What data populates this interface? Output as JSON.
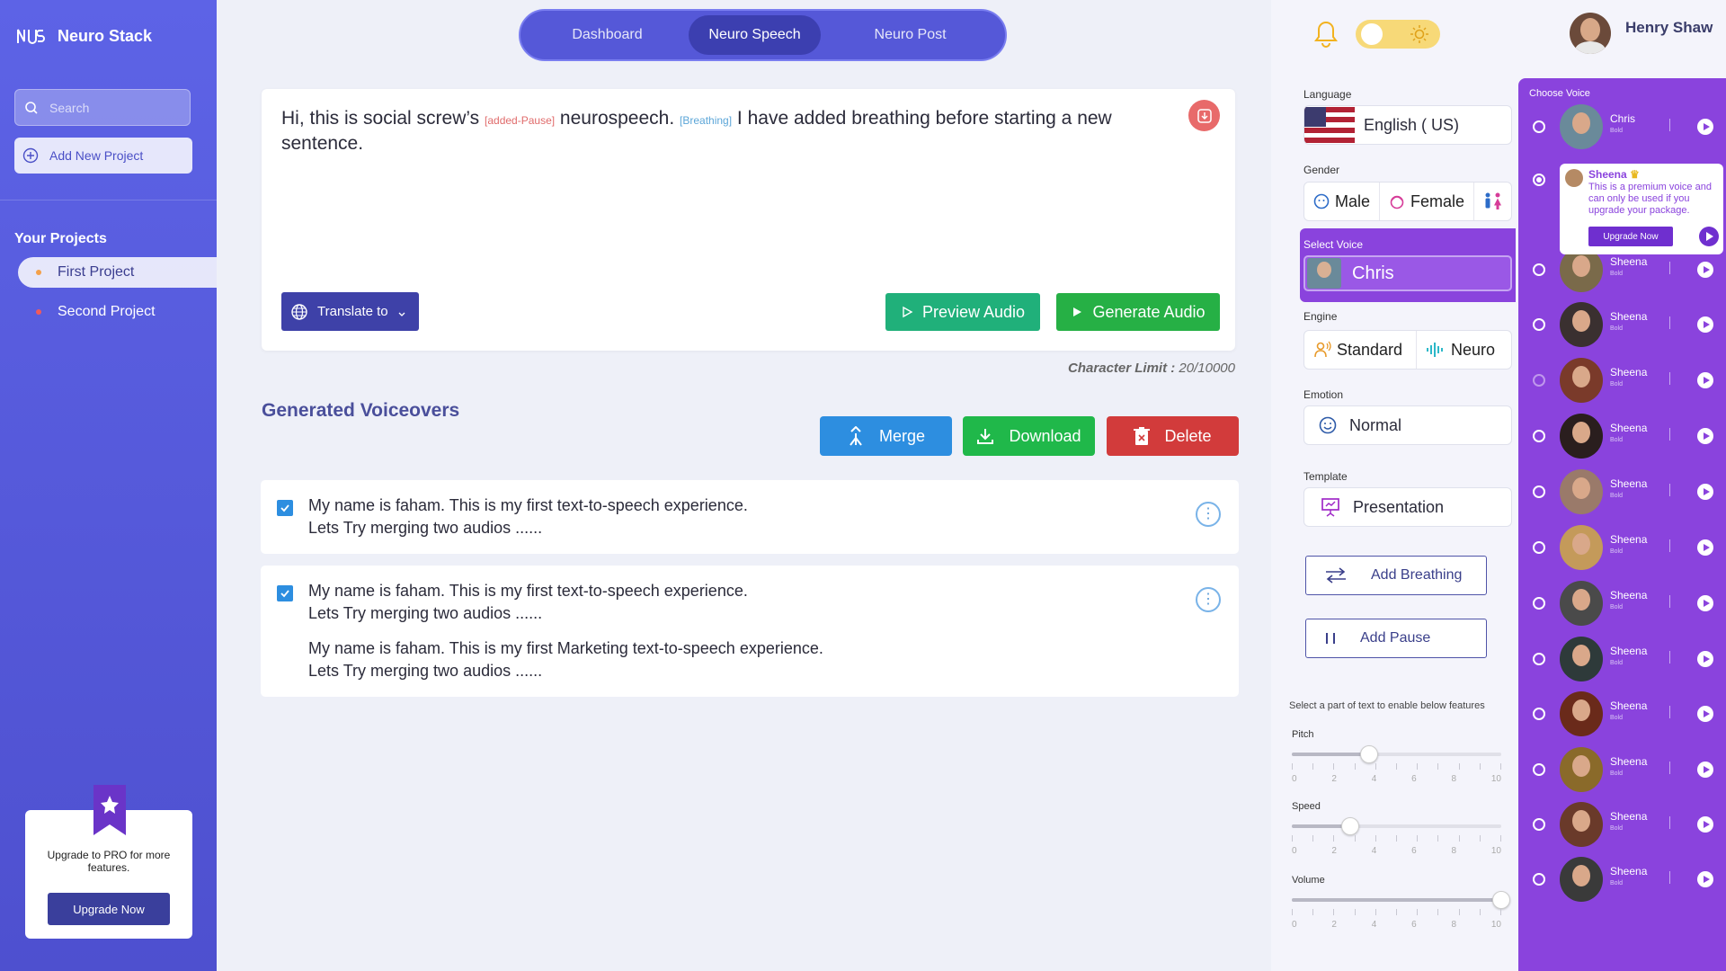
{
  "app": {
    "name": "Neuro Stack"
  },
  "sidebar": {
    "search_placeholder": "Search",
    "add_project": "Add New Project",
    "projects_heading": "Your Projects",
    "projects": [
      {
        "label": "First Project",
        "dot_color": "#f4a04a",
        "active": true
      },
      {
        "label": "Second Project",
        "dot_color": "#f25a5a",
        "active": false
      }
    ],
    "upgrade": {
      "text": "Upgrade to PRO for more features.",
      "button": "Upgrade Now"
    }
  },
  "nav": {
    "tabs": [
      {
        "label": "Dashboard"
      },
      {
        "label": "Neuro Speech"
      },
      {
        "label": "Neuro Post"
      }
    ]
  },
  "editor": {
    "text_1": "Hi,  this is social screw’s",
    "tag_1": "[added-Pause]",
    "text_2": "neurospeech.",
    "tag_2": "[Breathing]",
    "text_3": "I have added breathing before starting a new sentence.",
    "translate_label": "Translate to",
    "preview_label": "Preview Audio",
    "generate_label": "Generate Audio"
  },
  "char_limit": {
    "label": "Character Limit :",
    "value": "20/10000"
  },
  "voiceovers": {
    "title": "Generated Voiceovers",
    "merge": "Merge",
    "download": "Download",
    "delete": "Delete",
    "items": [
      {
        "line1": "My name is faham. This is my first text-to-speech experience.",
        "line2": "Lets Try merging two audios  ......"
      },
      {
        "line1": "My name is faham. This is my first text-to-speech experience.",
        "line2": "Lets Try merging two audios  ......",
        "line3": "My name is faham. This is my first Marketing text-to-speech experience.",
        "line4": "Lets Try merging two audios  ......"
      }
    ]
  },
  "user": {
    "name": "Henry Shaw"
  },
  "settings": {
    "language_label": "Language",
    "language_value": "English ( US)",
    "gender_label": "Gender",
    "genders": [
      "Male",
      "Female"
    ],
    "select_voice_label": "Select Voice",
    "select_voice_value": "Chris",
    "engine_label": "Engine",
    "engines": [
      "Standard",
      "Neuro"
    ],
    "emotion_label": "Emotion",
    "emotion_value": "Normal",
    "template_label": "Template",
    "template_value": "Presentation",
    "add_breathing": "Add Breathing",
    "add_pause": "Add Pause",
    "hint": "Select a part of text to enable below features",
    "sliders": [
      {
        "label": "Pitch",
        "value": 3.7
      },
      {
        "label": "Speed",
        "value": 2.8
      },
      {
        "label": "Volume",
        "value": 10
      }
    ],
    "tick_labels": [
      "0",
      "2",
      "4",
      "6",
      "8",
      "10"
    ]
  },
  "voice_panel": {
    "title": "Choose Voice",
    "premium": {
      "name": "Sheena",
      "text": "This is a premium voice and can only be used if you upgrade your package.",
      "button": "Upgrade Now"
    },
    "voices": [
      {
        "name": "Chris",
        "sub": "Bold",
        "color": "#6a8a9a"
      },
      {
        "name": "Sheena",
        "sub": "Bold",
        "color": "#b58a64",
        "premium": true
      },
      {
        "name": "Sheena",
        "sub": "Bold",
        "color": "#7a6a4a"
      },
      {
        "name": "Sheena",
        "sub": "Bold",
        "color": "#3a3030"
      },
      {
        "name": "Sheena",
        "sub": "Bold",
        "color": "#7a3a2a",
        "dim": true
      },
      {
        "name": "Sheena",
        "sub": "Bold",
        "color": "#2a1e1e"
      },
      {
        "name": "Sheena",
        "sub": "Bold",
        "color": "#9a7a6a"
      },
      {
        "name": "Sheena",
        "sub": "Bold",
        "color": "#c49a5a"
      },
      {
        "name": "Sheena",
        "sub": "Bold",
        "color": "#4a4a4a"
      },
      {
        "name": "Sheena",
        "sub": "Bold",
        "color": "#2e3a3a"
      },
      {
        "name": "Sheena",
        "sub": "Bold",
        "color": "#6a2a1a"
      },
      {
        "name": "Sheena",
        "sub": "Bold",
        "color": "#8a6a2a"
      },
      {
        "name": "Sheena",
        "sub": "Bold",
        "color": "#6a3a2a"
      },
      {
        "name": "Sheena",
        "sub": "Bold",
        "color": "#3a3a3a"
      }
    ]
  },
  "colors": {
    "accent": "#5558d8",
    "purple": "#8a43dd",
    "green": "#20b05a",
    "red": "#d23b3b",
    "blue": "#2d8ee0"
  }
}
